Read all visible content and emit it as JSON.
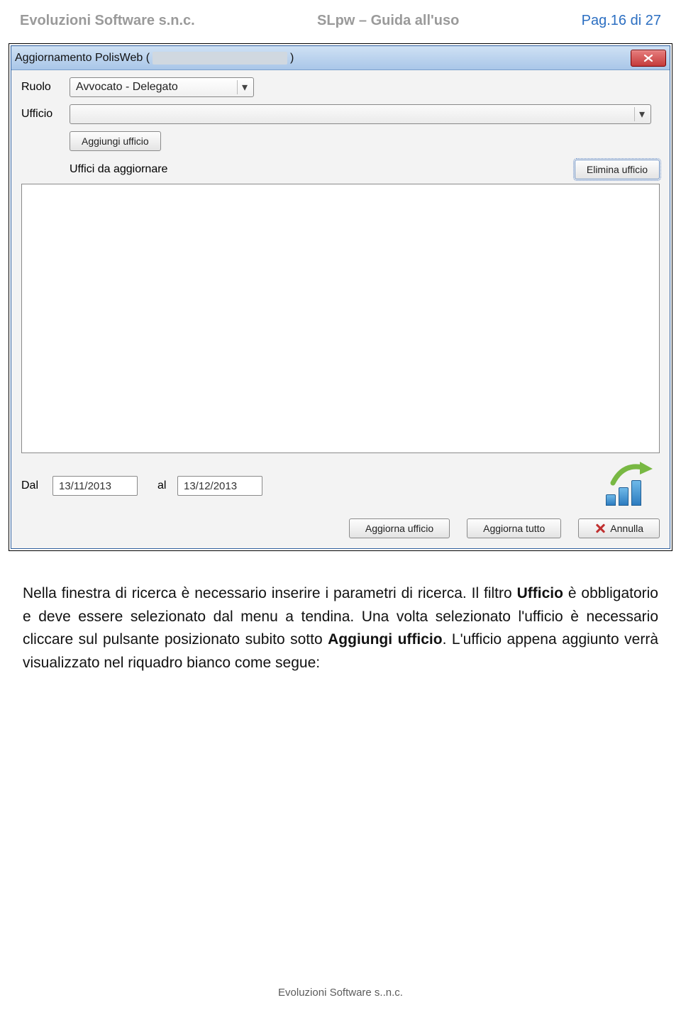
{
  "header": {
    "left": "Evoluzioni Software s.n.c.",
    "center": "SLpw – Guida all'uso",
    "right": "Pag.16 di 27"
  },
  "dialog": {
    "title_prefix": "Aggiornamento PolisWeb (",
    "title_suffix": ")",
    "labels": {
      "ruolo": "Ruolo",
      "ufficio": "Ufficio",
      "uffici_da_aggiornare": "Uffici da aggiornare",
      "dal": "Dal",
      "al": "al"
    },
    "ruolo_value": "Avvocato - Delegato",
    "ufficio_value": "",
    "buttons": {
      "aggiungi_ufficio": "Aggiungi ufficio",
      "elimina_ufficio": "Elimina ufficio",
      "aggiorna_ufficio": "Aggiorna ufficio",
      "aggiorna_tutto": "Aggiorna tutto",
      "annulla": "Annulla"
    },
    "dal_value": "13/11/2013",
    "al_value": "13/12/2013"
  },
  "paragraph": {
    "p1a": "Nella finestra di ricerca è necessario inserire i parametri di ricerca. Il filtro ",
    "p1b": "Ufficio",
    "p1c": " è obbligatorio e deve essere selezionato dal menu a tendina. Una volta selezionato l'ufficio è necessario cliccare sul pulsante posizionato subito sotto ",
    "p1d": "Aggiungi ufficio",
    "p1e": ". L'ufficio appena aggiunto verrà visualizzato nel riquadro bianco come segue:"
  },
  "footer": "Evoluzioni Software s..n.c."
}
